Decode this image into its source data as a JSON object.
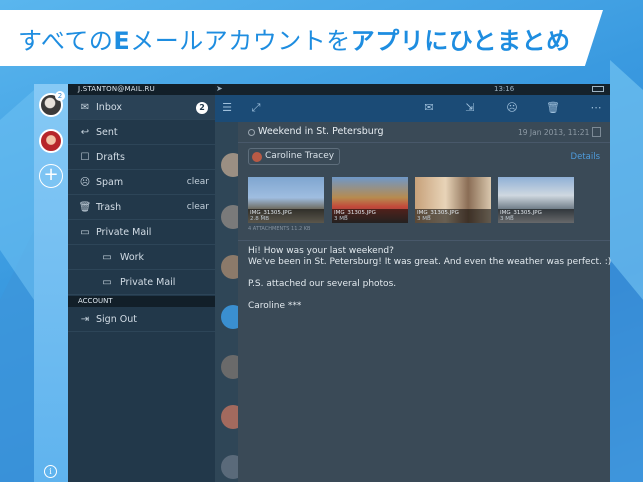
{
  "banner": {
    "text_a": "すべての",
    "text_b": "E",
    "text_c": "メールアカウントを",
    "text_d": "アプリ",
    "text_e": "にひとまとめ"
  },
  "status_bar": {
    "time": "13:16"
  },
  "accounts": {
    "badge": "2"
  },
  "sidebar": {
    "account_email": "J.STANTON@MAIL.RU",
    "folders": [
      {
        "label": "Inbox",
        "icon": "inbox-icon",
        "count": "2"
      },
      {
        "label": "Sent",
        "icon": "sent-icon"
      },
      {
        "label": "Drafts",
        "icon": "drafts-icon"
      },
      {
        "label": "Spam",
        "icon": "spam-icon",
        "action": "clear"
      },
      {
        "label": "Trash",
        "icon": "trash-icon",
        "action": "clear"
      },
      {
        "label": "Private Mail",
        "icon": "folder-icon"
      },
      {
        "label": "Work",
        "icon": "folder-icon"
      },
      {
        "label": "Private Mail",
        "icon": "folder-icon"
      }
    ],
    "section_account": "ACCOUNT",
    "sign_out": "Sign Out"
  },
  "message": {
    "subject": "Weekend in St. Petersburg",
    "date": "19 Jan 2013, 11:21",
    "from": "Caroline Tracey",
    "details": "Details",
    "attachments": [
      {
        "name": "IMG_31305.JPG",
        "size": "2.8 MB"
      },
      {
        "name": "IMG_31305.JPG",
        "size": "3 MB"
      },
      {
        "name": "IMG_31305.JPG",
        "size": "3 MB"
      },
      {
        "name": "IMG_31305.JPG",
        "size": "3 MB"
      }
    ],
    "attachments_summary": "4 ATTACHMENTS 11.2 KB",
    "body": [
      "Hi! How was your last weekend?",
      "We've been in St. Petersburg! It was great. And even the weather was perfect. :)",
      "P.S. attached our several photos.",
      "Caroline ***"
    ]
  },
  "colors": {
    "accent": "#1e8de0",
    "toolbar": "#1b4b76",
    "sidebar": "#22384a",
    "rail": "#6bbcf0"
  }
}
